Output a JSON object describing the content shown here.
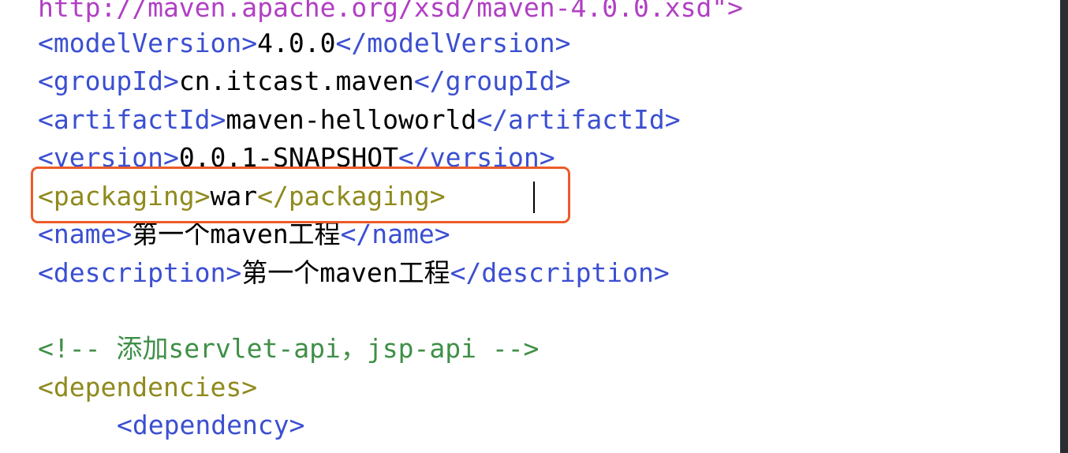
{
  "lines": {
    "line0": {
      "attr_value": "http://maven.apache.org/xsd/maven-4.0.0.xsd\">"
    },
    "line1": {
      "open": "<modelVersion>",
      "value": "4.0.0",
      "close": "</modelVersion>"
    },
    "line2": {
      "open": "<groupId>",
      "value": "cn.itcast.maven",
      "close": "</groupId>"
    },
    "line3": {
      "open": "<artifactId>",
      "value": "maven-helloworld",
      "close": "</artifactId>"
    },
    "line4": {
      "open": "<version>",
      "value": "0.0.1-SNAPSHOT",
      "close": "</version>"
    },
    "line5": {
      "open": "<packaging>",
      "value": "war",
      "close": "</packaging>"
    },
    "line6": {
      "open": "<name>",
      "value": "第一个maven工程",
      "close": "</name>"
    },
    "line7": {
      "open": "<description>",
      "value": "第一个maven工程",
      "close": "</description>"
    },
    "line9": {
      "comment": "<!-- 添加servlet-api，jsp-api -->"
    },
    "line10": {
      "open": "<dependencies>"
    },
    "line11": {
      "open": "<dependency>"
    }
  },
  "colors": {
    "tag": "#3b4fd1",
    "tag_amber": "#8f8a1d",
    "attribute_value": "#b13fc4",
    "comment": "#3f8f47",
    "highlight_border": "#ec5b2a"
  }
}
